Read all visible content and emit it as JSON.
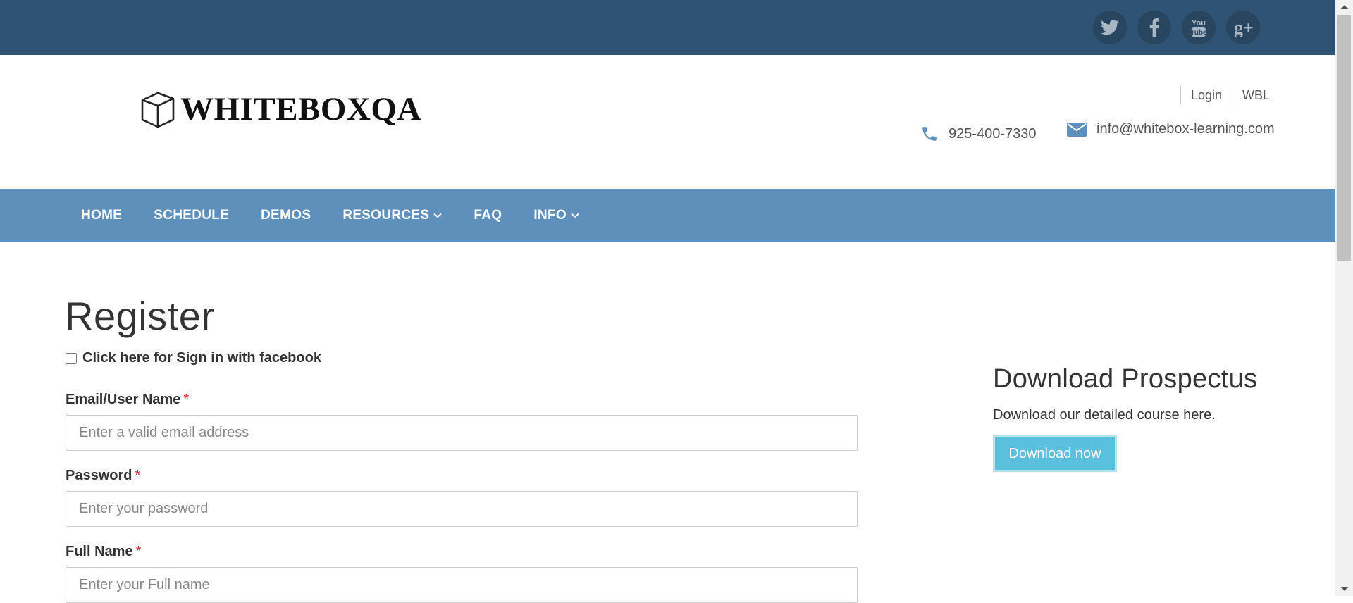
{
  "social": {
    "icons": [
      "twitter-icon",
      "facebook-icon",
      "youtube-icon",
      "google-plus-icon"
    ],
    "youtube_text": [
      "You",
      "Tube"
    ],
    "gplus_text": "g+"
  },
  "brand": {
    "logo_text": "WHITEBOXQA"
  },
  "header": {
    "links": [
      "Login",
      "WBL"
    ],
    "phone": "925-400-7330",
    "email": "info@whitebox-learning.com"
  },
  "nav": {
    "items": [
      {
        "label": "HOME",
        "has_dropdown": false
      },
      {
        "label": "SCHEDULE",
        "has_dropdown": false
      },
      {
        "label": "DEMOS",
        "has_dropdown": false
      },
      {
        "label": "RESOURCES",
        "has_dropdown": true
      },
      {
        "label": "FAQ",
        "has_dropdown": false
      },
      {
        "label": "INFO",
        "has_dropdown": true
      }
    ]
  },
  "form": {
    "title": "Register",
    "facebook_checkbox_label": "Click here for Sign in with facebook",
    "required_marker": "*",
    "fields": [
      {
        "label": "Email/User Name",
        "placeholder": "Enter a valid email address",
        "value": ""
      },
      {
        "label": "Password",
        "placeholder": "Enter your password",
        "value": ""
      },
      {
        "label": "Full Name",
        "placeholder": "Enter your Full name",
        "value": ""
      }
    ]
  },
  "sidebar": {
    "title": "Download Prospectus",
    "text": "Download our detailed course here.",
    "button_label": "Download now"
  },
  "colors": {
    "topbar": "#2f5372",
    "nav": "#5f90bb",
    "button": "#5bc0de",
    "contact_icon": "#5f90bb"
  }
}
